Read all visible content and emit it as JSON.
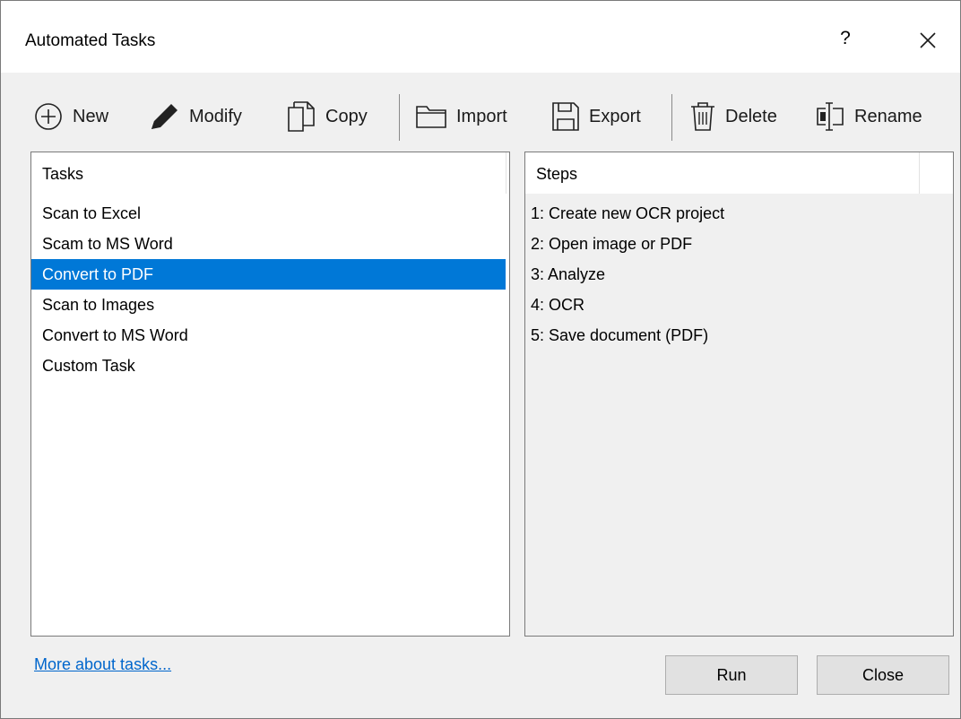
{
  "window": {
    "title": "Automated Tasks",
    "help_label": "?",
    "close_glyph": "close-icon"
  },
  "toolbar": {
    "items": [
      {
        "label": "New",
        "icon": "plus-circle-icon"
      },
      {
        "label": "Modify",
        "icon": "pencil-icon"
      },
      {
        "label": "Copy",
        "icon": "copy-icon"
      },
      {
        "label": "Import",
        "icon": "folder-icon"
      },
      {
        "label": "Export",
        "icon": "save-icon"
      },
      {
        "label": "Delete",
        "icon": "trash-icon"
      },
      {
        "label": "Rename",
        "icon": "rename-icon"
      }
    ]
  },
  "tasks": {
    "header": "Tasks",
    "items": [
      "Scan to Excel",
      "Scam to MS Word",
      "Convert to PDF",
      "Scan to Images",
      "Convert to MS Word",
      "Custom Task"
    ],
    "selected_index": 2
  },
  "steps": {
    "header": "Steps",
    "items": [
      "1: Create new OCR project",
      "2: Open image or PDF",
      "3: Analyze",
      "4: OCR",
      "5: Save document (PDF)"
    ]
  },
  "footer": {
    "link_label": "More about tasks...",
    "run_label": "Run",
    "close_label": "Close"
  },
  "colors": {
    "selection": "#0078d7",
    "link": "#0066cc",
    "dialog_bg": "#f0f0f0"
  }
}
